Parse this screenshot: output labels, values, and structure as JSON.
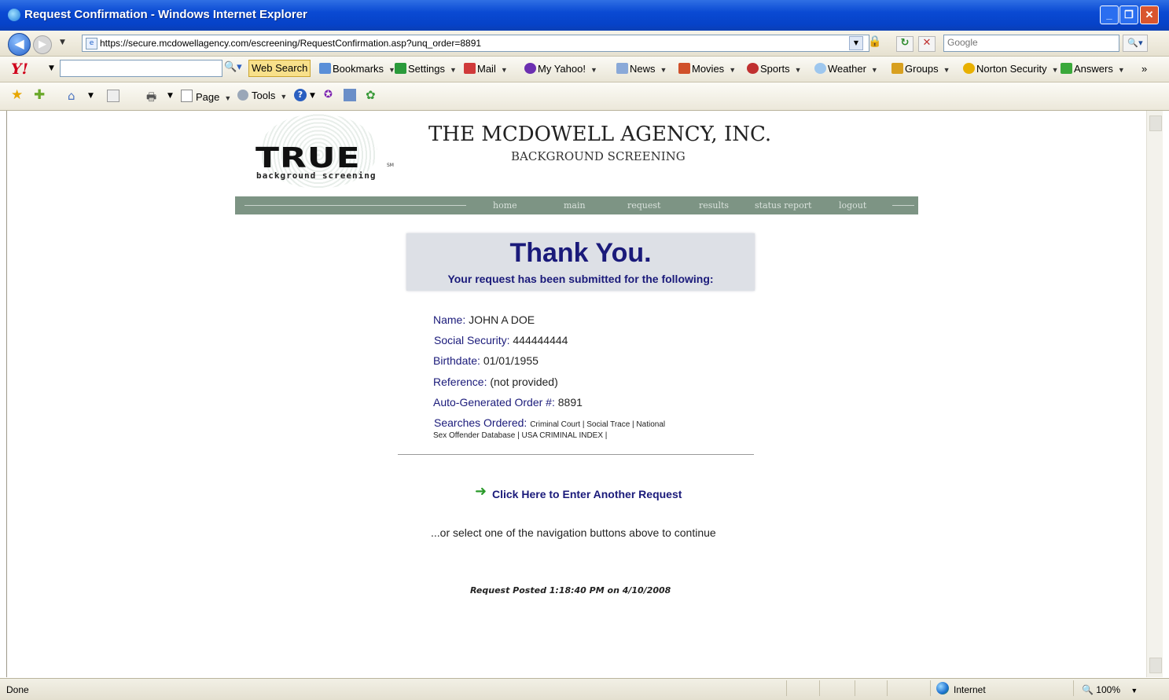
{
  "window": {
    "title": "Request Confirmation - Windows Internet Explorer",
    "min_label": "_",
    "max_label": "❐",
    "close_label": "✕"
  },
  "addressbar": {
    "url": "https://secure.mcdowellagency.com/escreening/RequestConfirmation.asp?unq_order=8891",
    "search_placeholder": "Google"
  },
  "yahoo_toolbar": {
    "logo": "Y!",
    "search_button": "Web Search",
    "items": {
      "bookmarks": "Bookmarks",
      "settings": "Settings",
      "mail": "Mail",
      "myyahoo": "My Yahoo!",
      "news": "News",
      "movies": "Movies",
      "sports": "Sports",
      "weather": "Weather",
      "groups": "Groups",
      "norton": "Norton Security",
      "answers": "Answers",
      "more": "»"
    }
  },
  "command_bar": {
    "page": "Page",
    "tools": "Tools"
  },
  "page": {
    "logo_text": "TRUE",
    "logo_tm": "SM",
    "logo_sub": "background screening",
    "agency_name": "THE MCDOWELL AGENCY, INC.",
    "agency_sub": "BACKGROUND SCREENING",
    "nav": {
      "home": "home",
      "main": "main",
      "request": "request",
      "results": "results",
      "status_report": "status report",
      "logout": "logout"
    },
    "thanks_title": "Thank You.",
    "thanks_sub": "Your request has been submitted for the following:",
    "fields": {
      "name_label": "Name:",
      "name_value": "JOHN  A  DOE",
      "ssn_label": "Social Security:",
      "ssn_value": "444444444",
      "birth_label": "Birthdate:",
      "birth_value": "01/01/1955",
      "ref_label": "Reference:",
      "ref_value": "(not provided)",
      "order_label": "Auto-Generated Order #:",
      "order_value": "8891",
      "searches_label": "Searches Ordered:",
      "searches_line1": "Criminal Court | Social Trace | National",
      "searches_line2": "Sex Offender Database | USA CRIMINAL INDEX |"
    },
    "another_link": "Click Here to Enter Another Request",
    "or_select": "...or select one of the navigation buttons above to continue",
    "posted": "Request Posted 1:18:40 PM on 4/10/2008"
  },
  "statusbar": {
    "status": "Done",
    "zone": "Internet",
    "zoom": "100%"
  }
}
